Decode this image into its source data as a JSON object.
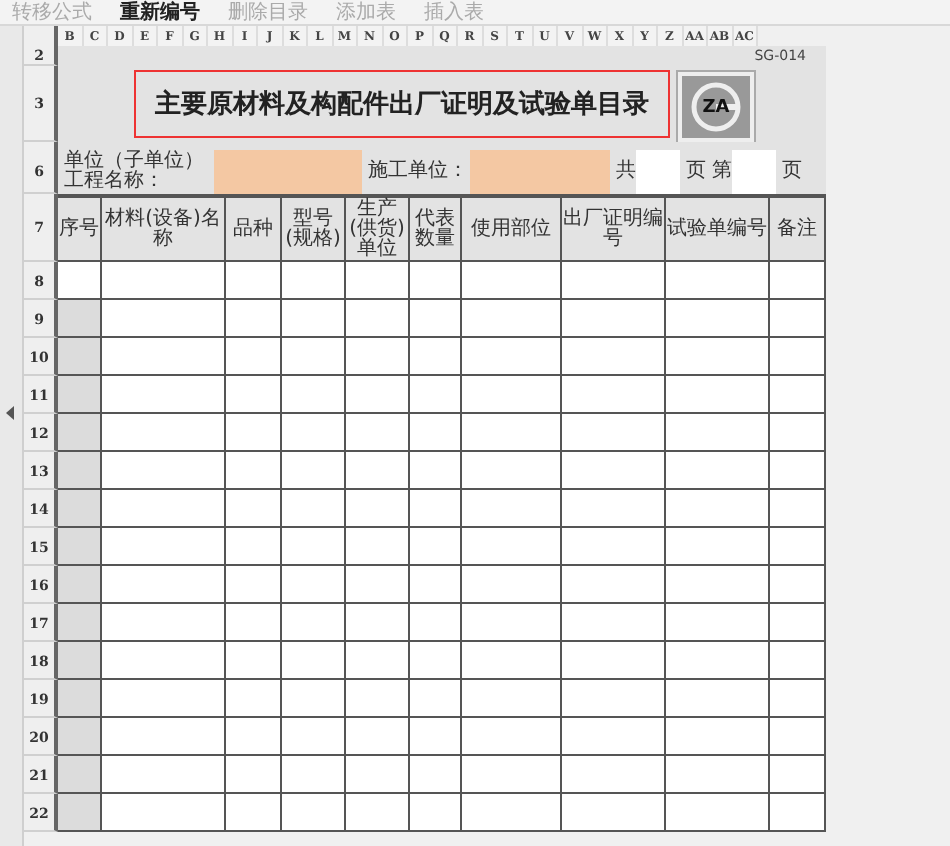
{
  "toolbar": [
    {
      "label": "转移公式",
      "disabled": true
    },
    {
      "label": "重新编号",
      "disabled": false
    },
    {
      "label": "删除目录",
      "disabled": true
    },
    {
      "label": "添加表",
      "disabled": true
    },
    {
      "label": "插入表",
      "disabled": true
    }
  ],
  "column_letters": [
    "B",
    "C",
    "D",
    "E",
    "F",
    "G",
    "H",
    "I",
    "J",
    "K",
    "L",
    "M",
    "N",
    "O",
    "P",
    "Q",
    "R",
    "S",
    "T",
    "U",
    "V",
    "W",
    "X",
    "Y",
    "Z",
    "AA",
    "AB",
    "AC"
  ],
  "code_row": {
    "row": "2",
    "code": "SG-014"
  },
  "title_row": {
    "row": "3",
    "title": "主要原材料及构配件出厂证明及试验单目录",
    "logo_text": "ZA"
  },
  "info_row": {
    "row": "6",
    "unit_label": "单位（子单位）工程名称：",
    "contractor_label": "施工单位：",
    "total_prefix": "共",
    "total_suffix": "页",
    "page_prefix": "第",
    "page_suffix": "页"
  },
  "header_row": {
    "row": "7",
    "columns": [
      "序号",
      "材料(设备)名称",
      "品种",
      "型号(规格)",
      "生产(供货)单位",
      "代表数量",
      "使用部位",
      "出厂证明编号",
      "试验单编号",
      "备注"
    ]
  },
  "rows": [
    {
      "row": "8",
      "selected": true
    },
    {
      "row": "9",
      "selected": false
    },
    {
      "row": "10",
      "selected": false
    },
    {
      "row": "11",
      "selected": false
    },
    {
      "row": "12",
      "selected": false
    },
    {
      "row": "13",
      "selected": false
    },
    {
      "row": "14",
      "selected": false
    },
    {
      "row": "15",
      "selected": false
    },
    {
      "row": "16",
      "selected": false
    },
    {
      "row": "17",
      "selected": false
    },
    {
      "row": "18",
      "selected": false
    },
    {
      "row": "19",
      "selected": false
    },
    {
      "row": "20",
      "selected": false
    },
    {
      "row": "21",
      "selected": false
    },
    {
      "row": "22",
      "selected": false
    }
  ]
}
